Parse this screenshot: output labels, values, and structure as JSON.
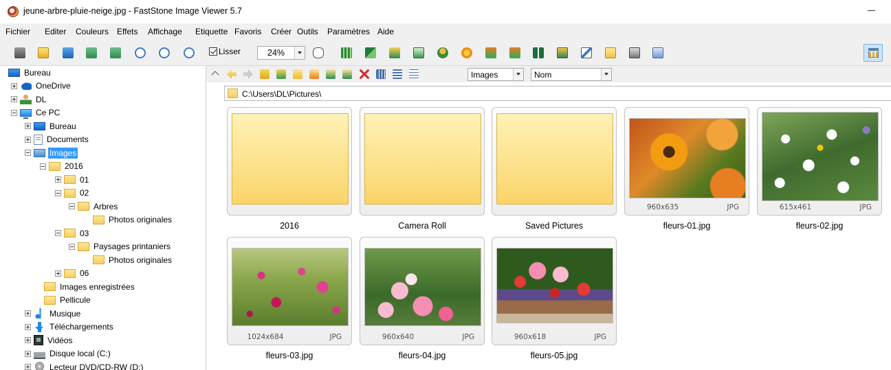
{
  "window": {
    "title": "jeune-arbre-pluie-neige.jpg  -  FastStone Image Viewer 5.7",
    "minimize_label": "—"
  },
  "menu": [
    "Fichier",
    "Editer",
    "Couleurs",
    "Effets",
    "Affichage",
    "Etiquette",
    "Favoris",
    "Créer",
    "Outils",
    "Paramètres",
    "Aide"
  ],
  "toolbar": {
    "smooth_label": "Lisser",
    "smooth_checked": true,
    "zoom_value": "24%",
    "icons": [
      "camera-icon",
      "open-folder-icon",
      "save-icon",
      "previous-icon",
      "next-icon",
      "zoom-in-icon",
      "zoom-out-icon",
      "actual-size-icon",
      "hand-tool-icon",
      "film-icon",
      "resize-icon",
      "crop-icon",
      "edit-text-icon",
      "user-stamp-icon",
      "sun-effect-icon",
      "rotate-left-icon",
      "rotate-right-icon",
      "compare-icon",
      "slideshow-icon",
      "draw-icon",
      "email-icon",
      "print-icon",
      "settings-icon"
    ],
    "layout_icon": "layout-toggle-icon"
  },
  "tree": [
    {
      "label": "Bureau",
      "icon": "desktop-icon",
      "expander": "none"
    },
    {
      "label": "OneDrive",
      "icon": "cloud-icon",
      "expander": "plus"
    },
    {
      "label": "DL",
      "icon": "user-icon",
      "expander": "plus"
    },
    {
      "label": "Ce PC",
      "icon": "computer-icon",
      "expander": "minus"
    },
    {
      "label": "Bureau",
      "icon": "desktop-icon",
      "expander": "plus"
    },
    {
      "label": "Documents",
      "icon": "document-icon",
      "expander": "plus"
    },
    {
      "label": "Images",
      "icon": "pictures-icon",
      "expander": "minus",
      "selected": true
    },
    {
      "label": "2016",
      "icon": "folder-icon",
      "expander": "minus"
    },
    {
      "label": "01",
      "icon": "folder-icon",
      "expander": "plus"
    },
    {
      "label": "02",
      "icon": "folder-icon",
      "expander": "minus"
    },
    {
      "label": "Arbres",
      "icon": "folder-icon",
      "expander": "minus"
    },
    {
      "label": "Photos originales",
      "icon": "folder-icon",
      "expander": "none"
    },
    {
      "label": "03",
      "icon": "folder-icon",
      "expander": "minus"
    },
    {
      "label": "Paysages printaniers",
      "icon": "folder-icon",
      "expander": "minus"
    },
    {
      "label": "Photos originales",
      "icon": "folder-icon",
      "expander": "none"
    },
    {
      "label": "06",
      "icon": "folder-icon",
      "expander": "plus"
    },
    {
      "label": "Images enregistrées",
      "icon": "folder-icon",
      "expander": "none"
    },
    {
      "label": "Pellicule",
      "icon": "folder-icon",
      "expander": "none"
    },
    {
      "label": "Musique",
      "icon": "music-icon",
      "expander": "plus"
    },
    {
      "label": "Téléchargements",
      "icon": "download-icon",
      "expander": "plus"
    },
    {
      "label": "Vidéos",
      "icon": "video-icon",
      "expander": "plus"
    },
    {
      "label": "Disque local (C:)",
      "icon": "disk-icon",
      "expander": "plus"
    },
    {
      "label": "Lecteur DVD/CD-RW (D:)",
      "icon": "dvd-icon",
      "expander": "plus"
    }
  ],
  "nav": {
    "filter_value": "Images",
    "sort_value": "Nom"
  },
  "path": "C:\\Users\\DL\\Pictures\\",
  "thumbnails": [
    {
      "name": "2016",
      "kind": "folder"
    },
    {
      "name": "Camera Roll",
      "kind": "folder"
    },
    {
      "name": "Saved Pictures",
      "kind": "folder"
    },
    {
      "name": "fleurs-01.jpg",
      "kind": "image",
      "dims": "960x635",
      "type": "JPG"
    },
    {
      "name": "fleurs-02.jpg",
      "kind": "image",
      "dims": "615x461",
      "type": "JPG"
    },
    {
      "name": "fleurs-03.jpg",
      "kind": "image",
      "dims": "1024x684",
      "type": "JPG"
    },
    {
      "name": "fleurs-04.jpg",
      "kind": "image",
      "dims": "960x640",
      "type": "JPG"
    },
    {
      "name": "fleurs-05.jpg",
      "kind": "image",
      "dims": "960x618",
      "type": "JPG"
    }
  ],
  "colors": {
    "selection": "#3399ff",
    "chrome": "#f0f0f0",
    "folder_face": "#fde28c"
  }
}
